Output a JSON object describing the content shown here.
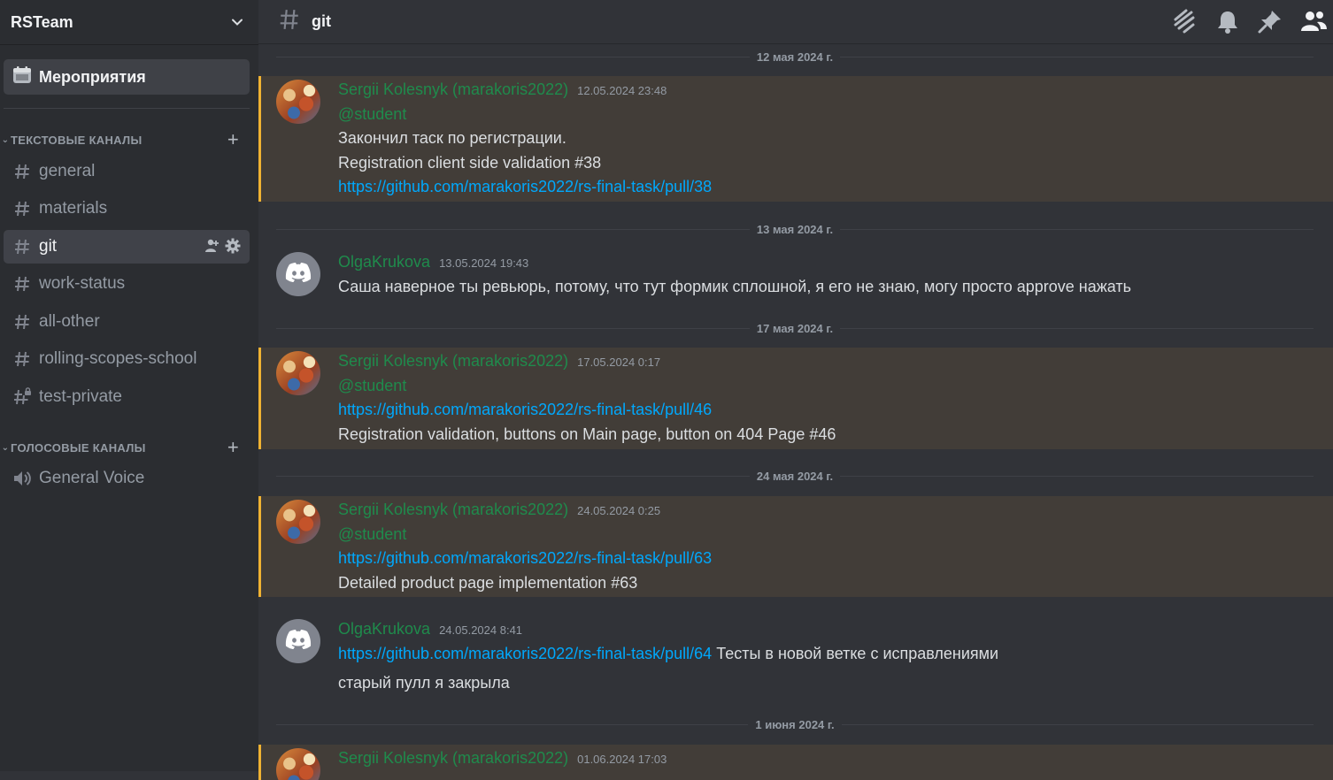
{
  "server": {
    "name": "RSTeam"
  },
  "sidebar": {
    "events_label": "Мероприятия",
    "categories": [
      {
        "label": "ТЕКСТОВЫЕ КАНАЛЫ"
      },
      {
        "label": "ГОЛОСОВЫЕ КАНАЛЫ"
      }
    ],
    "text_channels": [
      {
        "name": "general"
      },
      {
        "name": "materials"
      },
      {
        "name": "git"
      },
      {
        "name": "work-status"
      },
      {
        "name": "all-other"
      },
      {
        "name": "rolling-scopes-school"
      },
      {
        "name": "test-private"
      }
    ],
    "voice_channels": [
      {
        "name": "General Voice"
      }
    ]
  },
  "channel": {
    "name": "git"
  },
  "dividers": [
    "12 мая 2024 г.",
    "13 мая 2024 г.",
    "17 мая 2024 г.",
    "24 мая 2024 г.",
    "1 июня 2024 г."
  ],
  "messages": [
    {
      "author": "Sergii Kolesnyk  (marakoris2022)",
      "timestamp": "12.05.2024 23:48",
      "lines": [
        "@student",
        "Закончил таск по регистрации.",
        "Registration client side validation #38",
        "https://github.com/marakoris2022/rs-final-task/pull/38"
      ]
    },
    {
      "author": "OlgaKrukova",
      "timestamp": "13.05.2024 19:43",
      "lines": [
        "Саша наверное ты ревьюрь, потому, что тут формик сплошной, я его не знаю, могу просто approve нажать"
      ]
    },
    {
      "author": "Sergii Kolesnyk  (marakoris2022)",
      "timestamp": "17.05.2024 0:17",
      "lines": [
        "@student",
        "https://github.com/marakoris2022/rs-final-task/pull/46",
        "Registration validation, buttons on Main page, button on 404 Page #46"
      ]
    },
    {
      "author": "Sergii Kolesnyk  (marakoris2022)",
      "timestamp": "24.05.2024 0:25",
      "lines": [
        "@student",
        "https://github.com/marakoris2022/rs-final-task/pull/63",
        "Detailed product page implementation #63"
      ]
    },
    {
      "author": "OlgaKrukova",
      "timestamp": "24.05.2024 8:41",
      "lines": [
        "https://github.com/marakoris2022/rs-final-task/pull/64",
        "Тесты в новой ветке с исправлениями",
        "старый пулл я закрыла"
      ]
    },
    {
      "author": "Sergii Kolesnyk  (marakoris2022)",
      "timestamp": "01.06.2024 17:03",
      "lines": []
    }
  ],
  "colors": {
    "mention_highlight": "#423d38",
    "highlight_border": "#f0b232",
    "role_green": "#1f8b4c",
    "link": "#00a8fc"
  },
  "icons": [
    "chevron-down-icon",
    "calendar-icon",
    "hash-icon",
    "plus-icon",
    "add-member-icon",
    "gear-icon",
    "speaker-icon",
    "threads-icon",
    "bell-icon",
    "pin-icon",
    "members-icon",
    "discord-logo-icon"
  ]
}
